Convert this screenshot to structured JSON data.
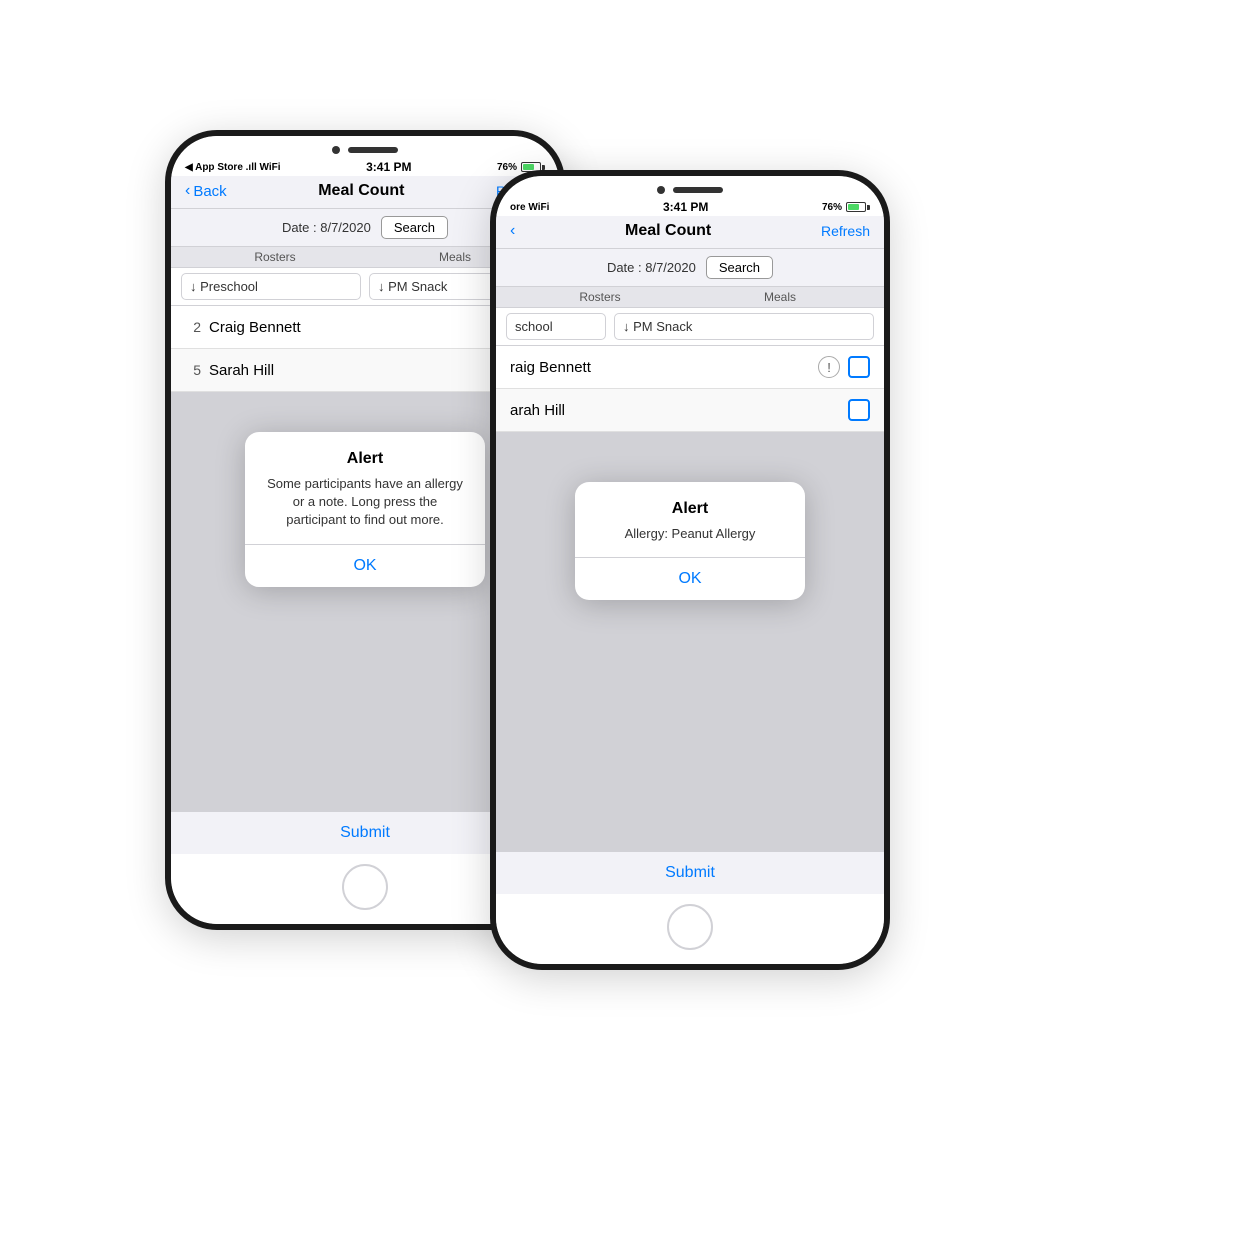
{
  "phone1": {
    "statusBar": {
      "left": "◀ App Store  .ıll  WiFi",
      "time": "3:41 PM",
      "right": "76%"
    },
    "navBar": {
      "back": "Back",
      "title": "Meal Count",
      "refresh": "Refresh"
    },
    "dateBar": {
      "dateLabel": "Date : 8/7/2020",
      "searchButton": "Search"
    },
    "columns": {
      "rosters": "Rosters",
      "meals": "Meals"
    },
    "dropdowns": {
      "roster": "↓ Preschool",
      "meal": "↓ PM Snack"
    },
    "participants": [
      {
        "number": "2",
        "name": "Craig Bennett",
        "hasAlert": true
      },
      {
        "number": "5",
        "name": "Sarah Hill",
        "hasAlert": false
      }
    ],
    "alert": {
      "title": "Alert",
      "message": "Some participants have an allergy or a note. Long press the participant to find out more.",
      "ok": "OK"
    },
    "submit": "Submit"
  },
  "phone2": {
    "statusBar": {
      "left": "ore  WiFi",
      "time": "3:41 PM",
      "right": "76%"
    },
    "navBar": {
      "back": "‹",
      "title": "Meal Count",
      "refresh": "Refresh"
    },
    "dateBar": {
      "dateLabel": "Date : 8/7/2020",
      "searchButton": "Search"
    },
    "columns": {
      "rosters": "Rosters",
      "meals": "Meals"
    },
    "dropdowns": {
      "roster": "school",
      "meal": "↓ PM Snack"
    },
    "participants": [
      {
        "number": "",
        "name": "raig Bennett",
        "hasAlert": true
      },
      {
        "number": "",
        "name": "arah Hill",
        "hasAlert": false
      }
    ],
    "alert": {
      "title": "Alert",
      "message": "Allergy: Peanut Allergy",
      "ok": "OK"
    },
    "submit": "Submit"
  }
}
